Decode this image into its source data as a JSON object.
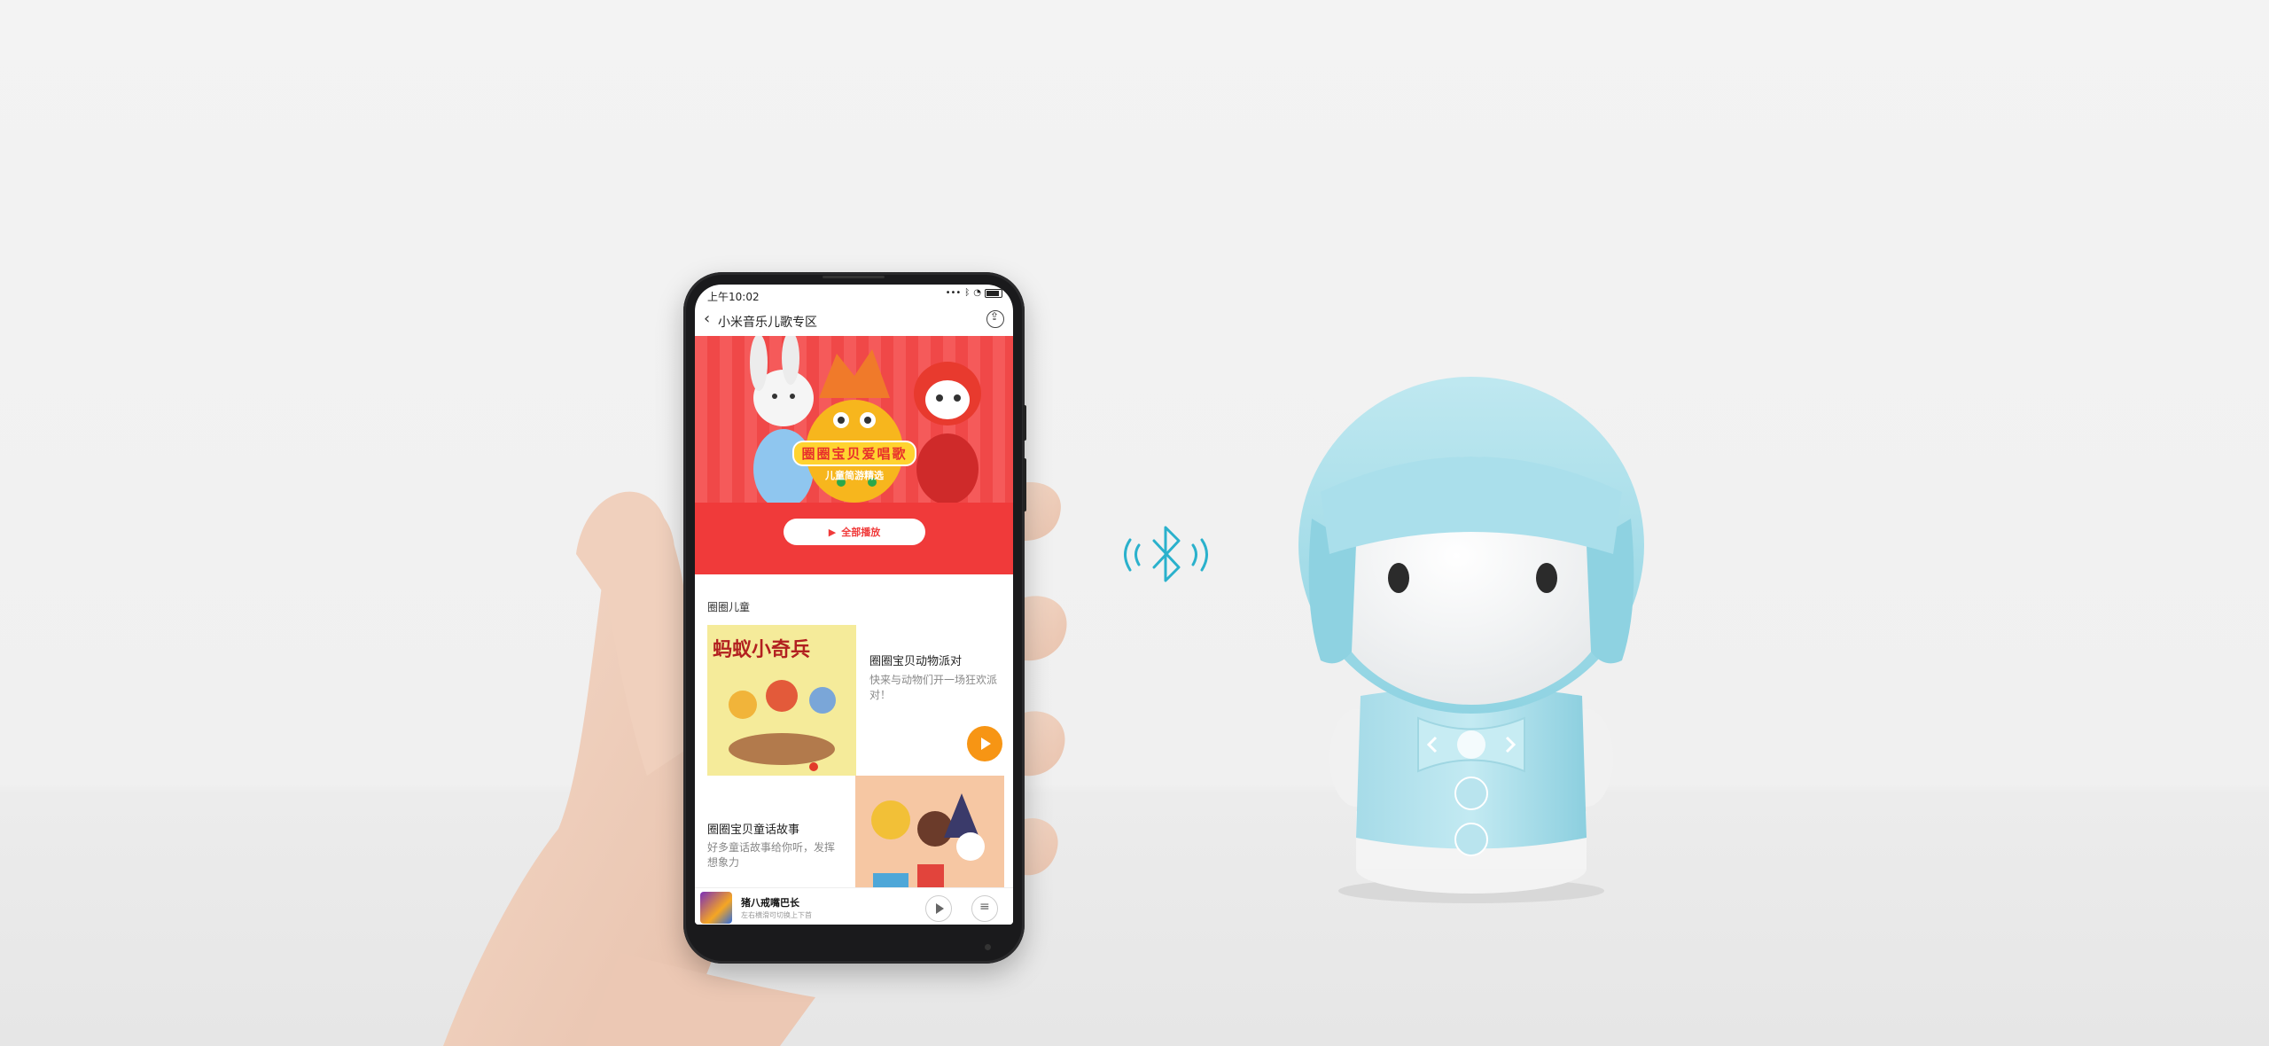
{
  "status_bar": {
    "time": "上午10:02",
    "icons": [
      "signal-icon",
      "bluetooth-icon",
      "wifi-icon",
      "battery-icon"
    ]
  },
  "navbar": {
    "title": "小米音乐儿歌专区"
  },
  "banner": {
    "caption_main": "圈圈宝贝爱唱歌",
    "caption_sub": "儿童简游精选",
    "play_all_label": "全部播放"
  },
  "section": {
    "title": "圈圈儿童"
  },
  "cards": [
    {
      "title": "圈圈宝贝动物派对",
      "description": "快来与动物们开一场狂欢派对！",
      "thumb_text": "蚂蚁小奇兵"
    },
    {
      "title": "圈圈宝贝童话故事",
      "description": "好多童话故事给你听，发挥想象力"
    }
  ],
  "player": {
    "title": "猪八戒嘴巴长",
    "subtitle": "左右横滑可切换上下首"
  },
  "colors": {
    "banner_red": "#f03a3a",
    "accent_orange": "#f79514",
    "robot_blue": "#a9dde8",
    "bluetooth_blue": "#2ab1cc"
  }
}
